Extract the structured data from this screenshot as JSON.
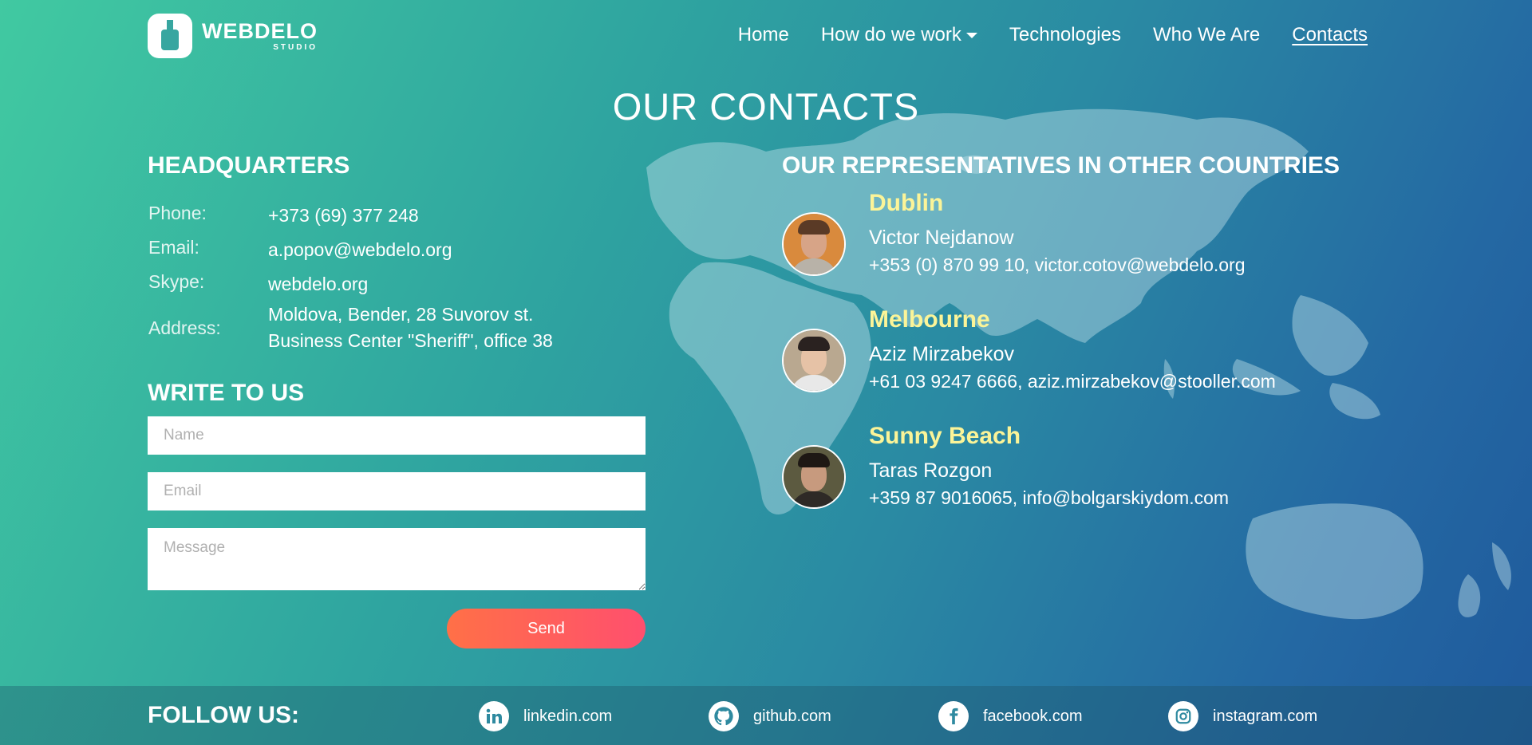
{
  "header": {
    "logo_name": "WEBDELO",
    "logo_sub": "STUDIO",
    "nav": {
      "home": "Home",
      "how": "How do we work",
      "tech": "Technologies",
      "who": "Who We Are",
      "contacts": "Contacts"
    }
  },
  "page_title": "OUR CONTACTS",
  "headquarters": {
    "title": "HEADQUARTERS",
    "phone_label": "Phone:",
    "phone": "+373 (69) 377 248",
    "email_label": "Email:",
    "email": "a.popov@webdelo.org",
    "skype_label": "Skype:",
    "skype": "webdelo.org",
    "address_label": "Address:",
    "address": "Moldova, Bender, 28 Suvorov st. Business Center \"Sheriff\", office 38"
  },
  "form": {
    "title": "WRITE TO US",
    "name_placeholder": "Name",
    "email_placeholder": "Email",
    "message_placeholder": "Message",
    "send_label": "Send"
  },
  "representatives": {
    "title": "OUR REPRESENTATIVES IN OTHER COUNTRIES",
    "items": [
      {
        "city": "Dublin",
        "name": "Victor Nejdanow",
        "contact": "+353 (0) 870 99 10, victor.cotov@webdelo.org"
      },
      {
        "city": "Melbourne",
        "name": "Aziz Mirzabekov",
        "contact": "+61 03 9247 6666, aziz.mirzabekov@stooller.com"
      },
      {
        "city": "Sunny Beach",
        "name": "Taras Rozgon",
        "contact": "+359 87 9016065, info@bolgarskiydom.com"
      }
    ]
  },
  "footer": {
    "follow": "FOLLOW US:",
    "links": [
      {
        "label": "linkedin.com",
        "icon": "linkedin-icon"
      },
      {
        "label": "github.com",
        "icon": "github-icon"
      },
      {
        "label": "facebook.com",
        "icon": "facebook-icon"
      },
      {
        "label": "instagram.com",
        "icon": "instagram-icon"
      }
    ]
  },
  "colors": {
    "accent_city": "#fbf498",
    "send_start": "#ff7047",
    "send_end": "#ff4f6e"
  }
}
